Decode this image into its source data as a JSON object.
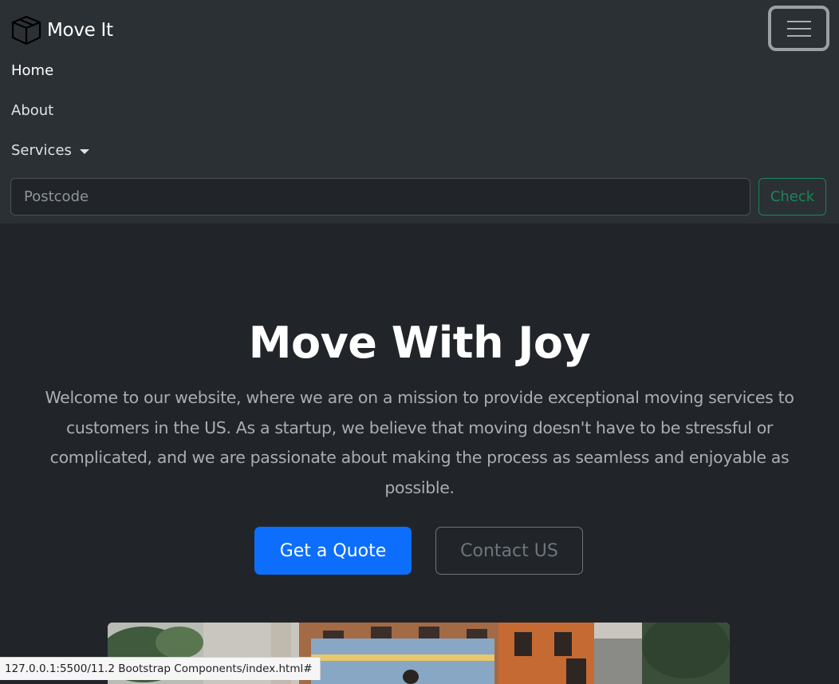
{
  "navbar": {
    "brand_name": "Move It",
    "brand_icon": "box-icon",
    "links": [
      "Home",
      "About",
      "Services"
    ],
    "search": {
      "placeholder": "Postcode",
      "button_label": "Check"
    }
  },
  "hero": {
    "title": "Move With Joy",
    "lead": "Welcome to our website, where we are on a mission to provide exceptional moving services to customers in the US. As a startup, we believe that moving doesn't have to be stressful or complicated, and we are passionate about making the process as seamless and enjoyable as possible.",
    "primary_button": "Get a Quote",
    "secondary_button": "Contact US"
  },
  "status_bar": {
    "url": "127.0.0.1:5500/11.2 Bootstrap Components/index.html#"
  },
  "colors": {
    "navbar_bg": "#2b3035",
    "page_bg": "#212529",
    "primary": "#0d6efd",
    "success": "#198754",
    "secondary": "#6c757d"
  }
}
